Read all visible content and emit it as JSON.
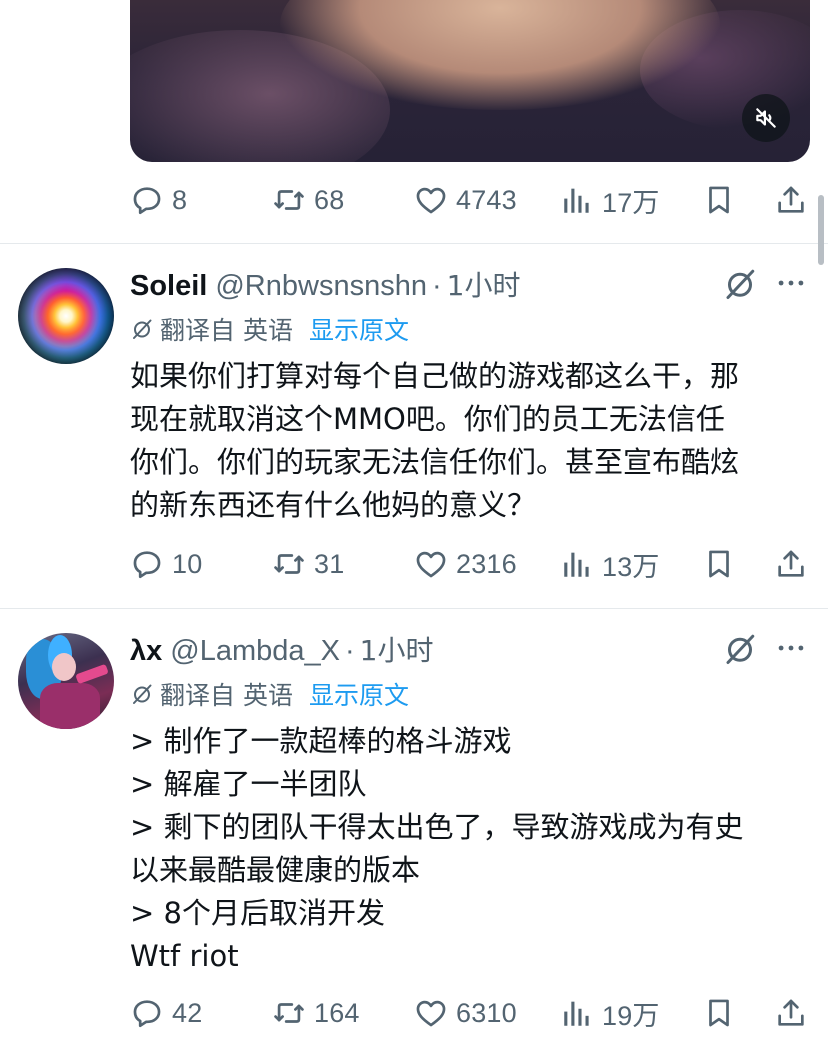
{
  "media": {
    "mute_icon": "speaker-muted-icon"
  },
  "top_actions": {
    "replies": "8",
    "reposts": "68",
    "likes": "4743",
    "views": "17万"
  },
  "tweets": [
    {
      "name": "Soleil",
      "handle": "@Rnbwsnsnshn",
      "separator": "·",
      "time": "1小时",
      "translate_label": "翻译自 英语",
      "show_original": "显示原文",
      "lines": [
        "如果你们打算对每个自己做的游戏都这么干，那",
        "现在就取消这个MMO吧。你们的员工无法信任",
        "你们。你们的玩家无法信任你们。甚至宣布酷炫",
        "的新东西还有什么他妈的意义？"
      ],
      "actions": {
        "replies": "10",
        "reposts": "31",
        "likes": "2316",
        "views": "13万"
      }
    },
    {
      "name": "λx",
      "handle": "@Lambda_X",
      "separator": "·",
      "time": "1小时",
      "translate_label": "翻译自 英语",
      "show_original": "显示原文",
      "lines": [
        "> 制作了一款超棒的格斗游戏",
        "> 解雇了一半团队",
        "> 剩下的团队干得太出色了，导致游戏成为有史",
        "以来最酷最健康的版本",
        "> 8个月后取消开发",
        "Wtf riot"
      ],
      "actions": {
        "replies": "42",
        "reposts": "164",
        "likes": "6310",
        "views": "19万"
      }
    }
  ],
  "colors": {
    "text": "#0f1419",
    "secondary": "#536471",
    "link": "#1d9bf0",
    "divider": "#e5e9ec"
  }
}
